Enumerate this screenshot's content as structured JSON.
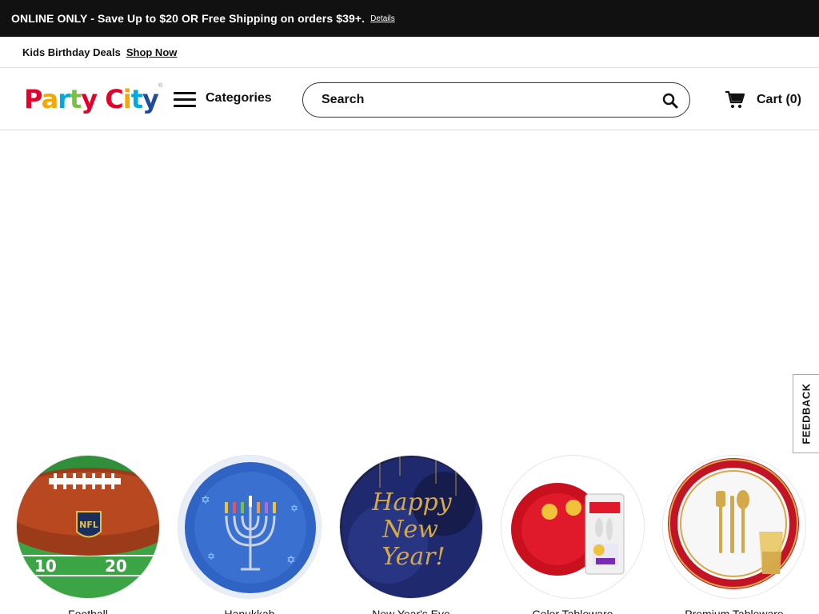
{
  "promo": {
    "text": "ONLINE ONLY - Save Up to $20 OR Free Shipping on orders $39+.",
    "details_link": "Details"
  },
  "subbar": {
    "label": "Kids Birthday Deals",
    "link": "Shop Now"
  },
  "header": {
    "logo_alt": "Party City",
    "logo_letters": [
      "P",
      "a",
      "r",
      "t",
      "y",
      " ",
      "C",
      "i",
      "t",
      "y"
    ],
    "logo_colors": [
      "#e4002b",
      "#f5a800",
      "#00a9e0",
      "#7ac143",
      "#e4002b",
      " ",
      "#e4002b",
      "#f5a800",
      "#00a9e0",
      "#1f4d9b"
    ],
    "categories_label": "Categories",
    "search": {
      "placeholder": "Search",
      "value": ""
    },
    "cart_label": "Cart (0)"
  },
  "feedback_label": "FEEDBACK",
  "categories": [
    {
      "label": "Football",
      "icon": "football-plate-icon"
    },
    {
      "label": "Hanukkah",
      "icon": "menorah-plate-icon"
    },
    {
      "label": "New Year's Eve",
      "icon": "happy-new-year-plate-icon"
    },
    {
      "label": "Color Tableware",
      "icon": "red-plate-icon"
    },
    {
      "label": "Premium Tableware",
      "icon": "gold-tableware-icon"
    }
  ],
  "colors": {
    "promo_bg": "#111111",
    "accent_red": "#e4002b",
    "navy": "#1f2a5e",
    "gold": "#d4a94a"
  }
}
